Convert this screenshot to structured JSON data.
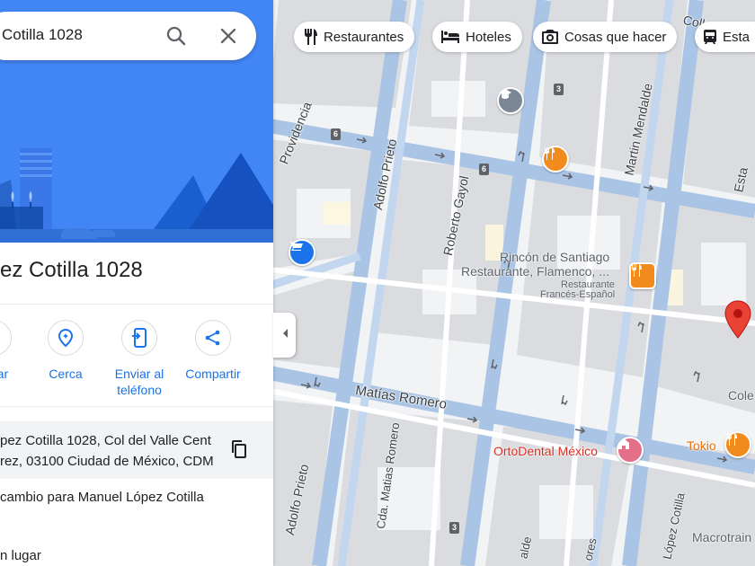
{
  "search": {
    "query": "Cotilla 1028"
  },
  "place": {
    "title": "ez Cotilla 1028",
    "address_line1": "pez Cotilla 1028, Col del Valle Cent",
    "address_line2": "rez, 03100 Ciudad de México, CDM",
    "suggest_edit": "cambio para Manuel López Cotilla",
    "add_place": "n lugar"
  },
  "actions": [
    {
      "label": "dar",
      "icon": "save-icon"
    },
    {
      "label": "Cerca",
      "icon": "nearby-icon"
    },
    {
      "label_1": "Enviar al",
      "label_2": "teléfono",
      "icon": "send-to-phone-icon"
    },
    {
      "label": "Compartir",
      "icon": "share-icon"
    }
  ],
  "chips": [
    {
      "label": "Restaurantes",
      "icon": "restaurant-icon"
    },
    {
      "label": "Hoteles",
      "icon": "hotel-icon"
    },
    {
      "label": "Cosas que hacer",
      "icon": "camera-icon"
    },
    {
      "label": "Esta",
      "icon": "transit-icon"
    }
  ],
  "map": {
    "streets": {
      "providencia": "Providencia",
      "adolfo_prieto": "Adolfo Prieto",
      "roberto_gayol": "Roberto Gayol",
      "martin_mendalde": "Martin Mendalde",
      "matias_romero": "Matías Romero",
      "cda_matias_romero": "Cda. Matias Romero",
      "lopez_cotilla": "López Cotilla",
      "fragment_right": "Esta",
      "fragment_bottom1": "alde",
      "fragment_bottom2": "ores",
      "top_fragment": "Colle"
    },
    "route_numbers": {
      "r6a": "6",
      "r6b": "6",
      "r3a": "3",
      "r3b": "3"
    },
    "pois": {
      "rincon_line1": "Rincón de Santiago",
      "rincon_line2": "Restaurante, Flamenco, ...",
      "frances_line1": "Restaurante",
      "frances_line2": "Francés-Español",
      "ortodental": "OrtoDental México",
      "tokio": "Tokio",
      "cole": "Cole",
      "macrotrain": "Macrotrain"
    },
    "colors": {
      "road": "#a9c4e4",
      "block": "#d3d6da",
      "poi_red": "#d93025",
      "poi_orange": "#f28b1e",
      "blue": "#1a73e8"
    }
  }
}
